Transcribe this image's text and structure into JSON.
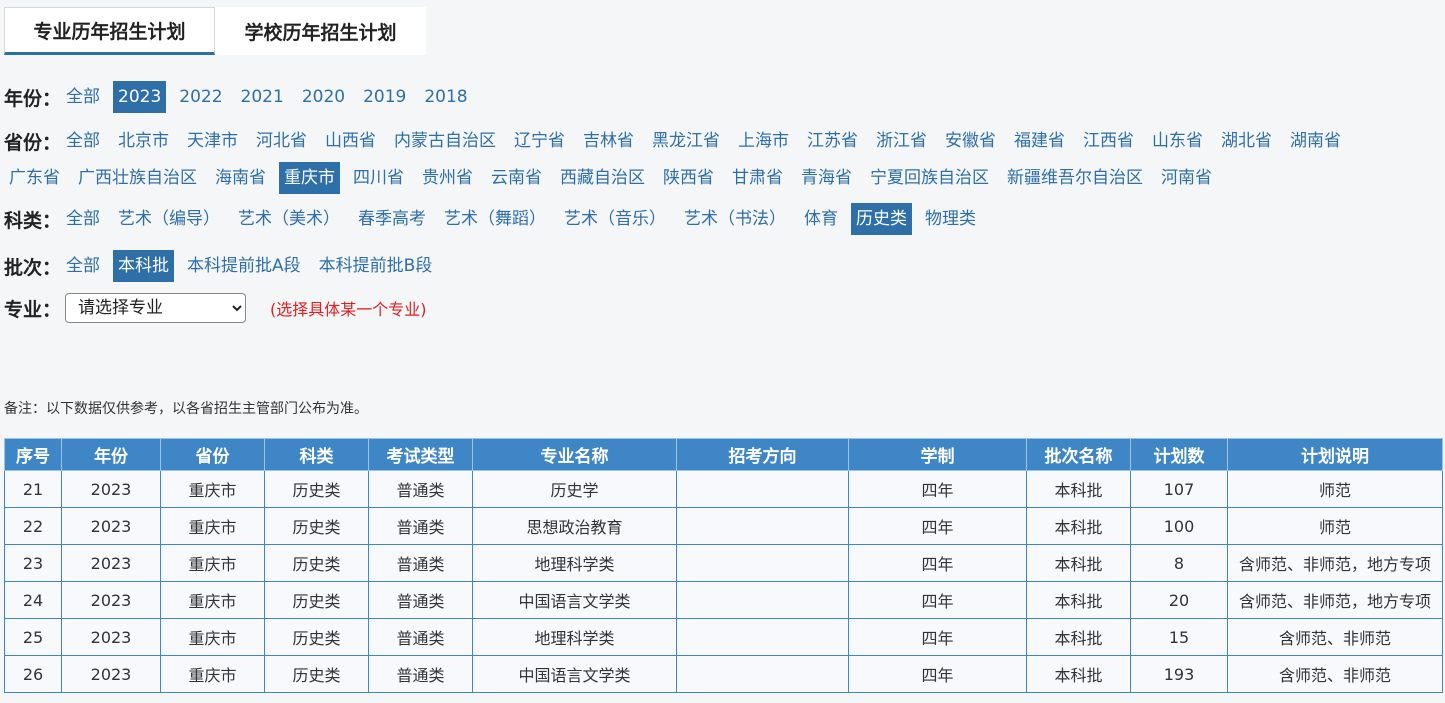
{
  "tabs": [
    {
      "label": "专业历年招生计划",
      "active": true
    },
    {
      "label": "学校历年招生计划",
      "active": false
    }
  ],
  "filters": {
    "year": {
      "label": "年份：",
      "options": [
        "全部",
        "2023",
        "2022",
        "2021",
        "2020",
        "2019",
        "2018"
      ],
      "active": "2023"
    },
    "province": {
      "label": "省份：",
      "row1": [
        "全部",
        "北京市",
        "天津市",
        "河北省",
        "山西省",
        "内蒙古自治区",
        "辽宁省",
        "吉林省",
        "黑龙江省",
        "上海市",
        "江苏省",
        "浙江省",
        "安徽省",
        "福建省",
        "江西省",
        "山东省",
        "湖北省",
        "湖南省"
      ],
      "row2": [
        "广东省",
        "广西壮族自治区",
        "海南省",
        "重庆市",
        "四川省",
        "贵州省",
        "云南省",
        "西藏自治区",
        "陕西省",
        "甘肃省",
        "青海省",
        "宁夏回族自治区",
        "新疆维吾尔自治区",
        "河南省"
      ],
      "active": "重庆市"
    },
    "subject": {
      "label": "科类：",
      "options": [
        "全部",
        "艺术（编导）",
        "艺术（美术）",
        "春季高考",
        "艺术（舞蹈）",
        "艺术（音乐）",
        "艺术（书法）",
        "体育",
        "历史类",
        "物理类"
      ],
      "active": "历史类"
    },
    "batch": {
      "label": "批次：",
      "options": [
        "全部",
        "本科批",
        "本科提前批A段",
        "本科提前批B段"
      ],
      "active": "本科批"
    },
    "major": {
      "label": "专业：",
      "selected": "请选择专业",
      "hint": "(选择具体某一个专业)"
    }
  },
  "note": "备注：以下数据仅供参考，以各省招生主管部门公布为准。",
  "table": {
    "columns": [
      "序号",
      "年份",
      "省份",
      "科类",
      "考试类型",
      "专业名称",
      "招考方向",
      "学制",
      "批次名称",
      "计划数",
      "计划说明"
    ],
    "rows": [
      [
        "21",
        "2023",
        "重庆市",
        "历史类",
        "普通类",
        "历史学",
        "",
        "四年",
        "本科批",
        "107",
        "师范"
      ],
      [
        "22",
        "2023",
        "重庆市",
        "历史类",
        "普通类",
        "思想政治教育",
        "",
        "四年",
        "本科批",
        "100",
        "师范"
      ],
      [
        "23",
        "2023",
        "重庆市",
        "历史类",
        "普通类",
        "地理科学类",
        "",
        "四年",
        "本科批",
        "8",
        "含师范、非师范，地方专项"
      ],
      [
        "24",
        "2023",
        "重庆市",
        "历史类",
        "普通类",
        "中国语言文学类",
        "",
        "四年",
        "本科批",
        "20",
        "含师范、非师范，地方专项"
      ],
      [
        "25",
        "2023",
        "重庆市",
        "历史类",
        "普通类",
        "地理科学类",
        "",
        "四年",
        "本科批",
        "15",
        "含师范、非师范"
      ],
      [
        "26",
        "2023",
        "重庆市",
        "历史类",
        "普通类",
        "中国语言文学类",
        "",
        "四年",
        "本科批",
        "193",
        "含师范、非师范"
      ]
    ]
  },
  "colors": {
    "accent": "#2e6fa8",
    "header_bg": "#3f86c7",
    "hint": "#e02020"
  }
}
